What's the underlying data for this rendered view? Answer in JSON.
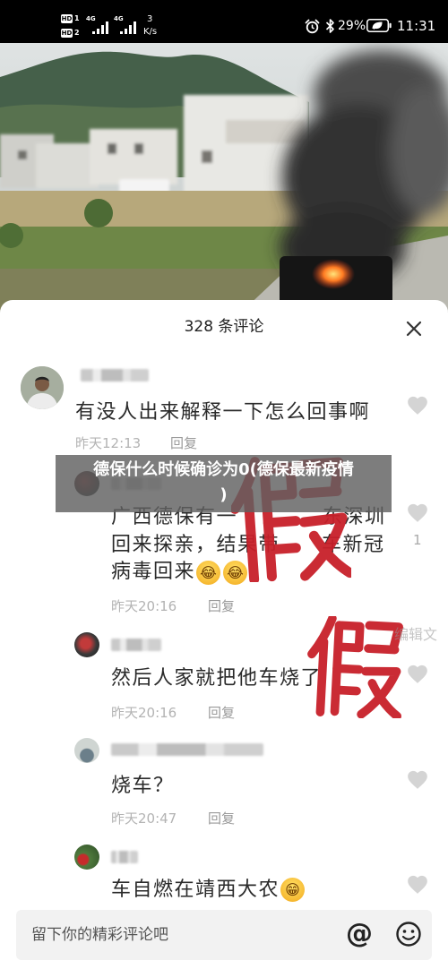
{
  "status_bar": {
    "sim1": {
      "badge": "HD",
      "slot": "1",
      "network": "4G"
    },
    "sim2": {
      "badge": "HD",
      "slot": "2",
      "network": "4G"
    },
    "net_speed": {
      "value": "3",
      "unit": "K/s"
    },
    "battery_percent": "29%",
    "time": "11:31",
    "icons": [
      "signal-icon",
      "alarm-clock-icon",
      "bluetooth-icon",
      "battery-saver-icon"
    ]
  },
  "video_overlay": {
    "title_line1": "德保什么时候确诊为0(德保最新疫情",
    "title_line2": ")",
    "watermark": "编辑文"
  },
  "stamp_text": "假",
  "comments_panel": {
    "header": "328 条评论",
    "close_icon": "close-icon",
    "like_icon": "heart-icon",
    "comments": [
      {
        "lines": [
          [
            "有没人出来解释一下怎么回事啊"
          ]
        ],
        "time": "昨天12:13",
        "reply": "回复"
      },
      {
        "lines": [
          [
            "广西德保有一",
            "东深圳"
          ],
          [
            "回来探亲，结果带",
            "车新冠"
          ],
          [
            "病毒回来"
          ]
        ],
        "emoji": [
          "😂",
          "😂"
        ],
        "time": "昨天20:16",
        "reply": "回复",
        "likes": "1"
      },
      {
        "lines": [
          [
            "然后人家就把他车烧了"
          ]
        ],
        "time": "昨天20:16",
        "reply": "回复"
      },
      {
        "lines": [
          [
            "烧车？"
          ]
        ],
        "time": "昨天20:47",
        "reply": "回复"
      },
      {
        "lines": [
          [
            "车自燃在靖西大农"
          ]
        ],
        "emoji": [
          "😁"
        ]
      }
    ]
  },
  "composer": {
    "placeholder": "留下你的精彩评论吧",
    "mention_symbol": "@",
    "icons": [
      "at-icon",
      "smiley-icon"
    ]
  },
  "colors": {
    "stamp_red": "#c8202a",
    "like_gray": "#d4d4d4",
    "meta_gray": "#b3b3b3",
    "banner_bg": "#606060",
    "text_dark": "#222222"
  }
}
